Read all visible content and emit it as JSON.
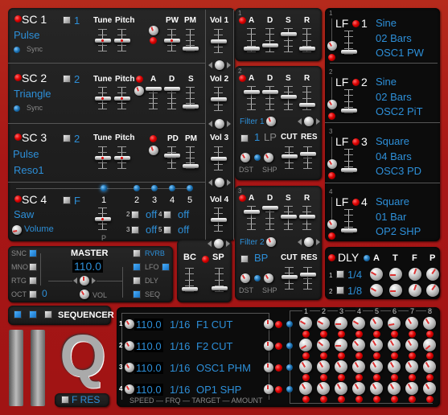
{
  "colors": {
    "background": "#a81616",
    "panel": "#1e1e1e",
    "accent_blue": "#2d8fd8",
    "led_red": "#dd0000"
  },
  "osc": [
    {
      "label": "SC 1",
      "num": "1",
      "wave": "Pulse",
      "extra": "",
      "sync": "Sync",
      "tune": "Tune",
      "pitch": "Pitch",
      "p1": "PW",
      "p2": "PM",
      "vol": "Vol 1"
    },
    {
      "label": "SC 2",
      "num": "2",
      "wave": "Triangle",
      "extra": "",
      "sync": "Sync",
      "tune": "Tune",
      "pitch": "Pitch",
      "a": "A",
      "d": "D",
      "s": "S",
      "vol": "Vol 2"
    },
    {
      "label": "SC 3",
      "num": "2",
      "wave": "Pulse",
      "extra": "Reso1",
      "tune": "Tune",
      "pitch": "Pitch",
      "p1": "PD",
      "p2": "PM",
      "vol": "Vol 3"
    },
    {
      "label": "SC 4",
      "num": "F",
      "wave": "Saw",
      "volume": "Volume",
      "steps": [
        "1",
        "2",
        "3",
        "4",
        "5"
      ],
      "p": "P",
      "slots": [
        {
          "n": "2",
          "v": "off"
        },
        {
          "n": "4",
          "v": "off"
        },
        {
          "n": "3",
          "v": "off"
        },
        {
          "n": "5",
          "v": "off"
        }
      ],
      "vol": "Vol 4"
    }
  ],
  "env": [
    {
      "n": "1",
      "a": "A",
      "d": "D",
      "s": "S",
      "r": "R",
      "levels": [
        0.1,
        0.25,
        0.8,
        0.1
      ]
    },
    {
      "n": "2",
      "a": "A",
      "d": "D",
      "s": "S",
      "r": "R",
      "levels": [
        0.8,
        0.8,
        0.55,
        0.15
      ],
      "filter": "Filter 1",
      "fnum": "1",
      "mode": "LP",
      "cut": "CUT",
      "res": "RES",
      "dst": "DST",
      "shp": "SHP"
    },
    {
      "n": "3",
      "a": "A",
      "d": "D",
      "s": "S",
      "r": "R",
      "levels": [
        0.8,
        1.0,
        0.55,
        0.55
      ],
      "filter": "Filter 2",
      "mode": "BP",
      "cut": "CUT",
      "res": "RES",
      "dst": "DST",
      "shp": "SHP"
    }
  ],
  "lfo": [
    {
      "n": "1",
      "label": "LF",
      "wave": "Sine",
      "rate": "02 Bars",
      "target": "OSC1 PW"
    },
    {
      "n": "2",
      "label": "LF",
      "wave": "Sine",
      "rate": "02 Bars",
      "target": "OSC2 PiT"
    },
    {
      "n": "3",
      "label": "LF",
      "wave": "Square",
      "rate": "04 Bars",
      "target": "OSC3 PD"
    },
    {
      "n": "4",
      "label": "LF",
      "wave": "Square",
      "rate": "01 Bar",
      "target": "OP2 SHP"
    }
  ],
  "dly": {
    "label": "DLY",
    "cols": [
      "A",
      "T",
      "F",
      "P"
    ],
    "rows": [
      {
        "n": "1",
        "v": "1/4"
      },
      {
        "n": "2",
        "v": "1/8"
      }
    ]
  },
  "master": {
    "title": "MASTER",
    "value": "110.0",
    "vol": "VOL",
    "snc": "SNC",
    "mno": "MNO",
    "rtg": "RTG",
    "oct": "OCT",
    "oct_value": "0",
    "rvrb": "RVRB",
    "lfo": "LFO",
    "dly": "DLY",
    "seq": "SEQ"
  },
  "bcsp": {
    "bc": "BC",
    "sp": "SP"
  },
  "sequencer": {
    "title": "SEQUENCER",
    "fres": "F RES",
    "logo": "Q",
    "rows": [
      {
        "n": "1",
        "speed": "110.0",
        "frq": "1/16",
        "target": "F1 CUT"
      },
      {
        "n": "2",
        "speed": "110.0",
        "frq": "1/16",
        "target": "F2 CUT"
      },
      {
        "n": "3",
        "speed": "110.0",
        "frq": "1/16",
        "target": "OSC1 PHM"
      },
      {
        "n": "4",
        "speed": "110.0",
        "frq": "1/16",
        "target": "OP1 SHP"
      }
    ],
    "steps": [
      "1",
      "2",
      "3",
      "4",
      "5",
      "6",
      "7",
      "8"
    ],
    "footer": "SPEED — FRQ — TARGET — AMOUNT"
  }
}
